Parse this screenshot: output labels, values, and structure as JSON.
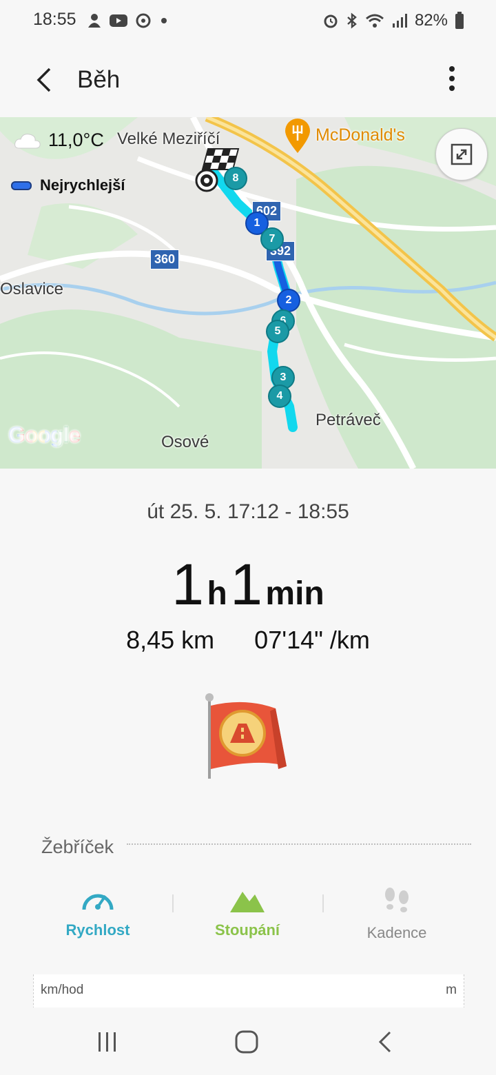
{
  "status_bar": {
    "time": "18:55",
    "battery_percent": "82%",
    "left_icons": [
      "face-icon",
      "youtube-icon",
      "sync-icon",
      "dot-icon"
    ],
    "right_icons": [
      "alarm-icon",
      "bluetooth-icon",
      "wifi-icon",
      "signal-icon",
      "battery-icon"
    ]
  },
  "app_bar": {
    "title": "Běh"
  },
  "map": {
    "weather_temp": "11,0°C",
    "legend_label": "Nejrychlejší",
    "places": {
      "velke": "Velké Meziříčí",
      "mcdonalds": "McDonald's",
      "oslavice": "Oslavice",
      "petravec": "Petráveč",
      "osove": "Osové"
    },
    "road_shields": {
      "r602": "602",
      "r392": "392",
      "r360": "360"
    },
    "markers": {
      "m1": "1",
      "m2": "2",
      "m3": "3",
      "m4": "4",
      "m5": "5",
      "m6": "6",
      "m7": "7",
      "m8": "8"
    },
    "google_logo": "Google",
    "colors": {
      "route_fast": "#1660e0",
      "route": "#12d8ee",
      "marker": "#1b9aa6"
    }
  },
  "summary": {
    "date_range": "út 25. 5. 17:12 - 18:55",
    "duration_hours": "1",
    "duration_hours_unit": "h",
    "duration_minutes": "1",
    "duration_minutes_unit": "min",
    "distance": "8,45 km",
    "pace": "07'14\" /km"
  },
  "leaderboard": {
    "heading": "Žebříček"
  },
  "tabs": [
    {
      "label": "Rychlost",
      "color": "#33a9c4",
      "icon": "speedometer-icon"
    },
    {
      "label": "Stoupání",
      "color": "#8bc34a",
      "icon": "mountain-icon"
    },
    {
      "label": "Kadence",
      "color": "#888888",
      "icon": "footsteps-icon"
    }
  ],
  "chart": {
    "y_left_unit": "km/hod",
    "y_right_unit": "m"
  }
}
